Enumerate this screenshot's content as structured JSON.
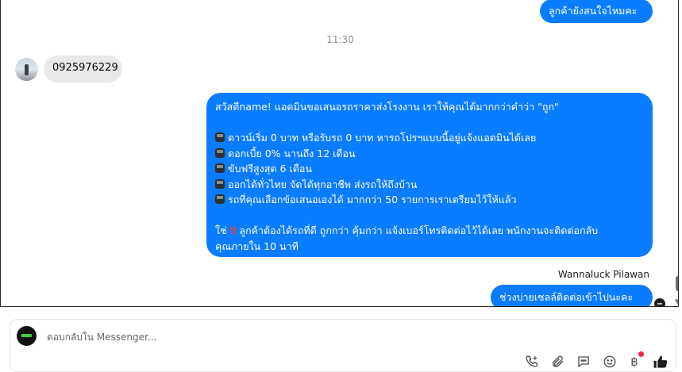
{
  "messages": {
    "top_outgoing": "ลูกค้ายังสนใจไหมคะ",
    "timestamp": "11:30",
    "incoming_phone": "0925976229",
    "long_outgoing": {
      "greeting": "สวัสดีname! แอดมินขอเสนอรถราคาส่งโรงงาน เราให้คุณได้มากกว่าคำว่า \"ถูก\"",
      "bullets": [
        "ดาวน์เริ่ม 0 บาท หรือรับรถ 0 บาท หารถโปรฯแบบนี้อยู่แจ้งแอดมินได้เลย",
        "ดอกเบี้ย 0% นานถึง 12 เดือน",
        "ขับฟรีสูงสุด 6 เดือน",
        "ออกได้ทั่วไทย จัดได้ทุกอาชีพ ส่งรถให้ถึงบ้าน",
        "รถที่คุณเลือกข้อเสนอเองได้ มากกว่า 50 รายการเราเตรียมไว้ให้แล้ว"
      ],
      "closing_prefix": "ใช่",
      "closing_rest": "ลูกค้าต้องได้รถที่ดี ถูกกว่า คุ้มกว่า แจ้งเบอร์โทรติดต่อไว้ได้เลย พนักงานจะติดต่อกลับ",
      "closing_line2": "คุณภายใน 10 นาที"
    },
    "sender_name": "Wannaluck Pilawan",
    "last_outgoing": "ช่วงบ่ายเซลล์ติดต่อเข้าไปนะคะ"
  },
  "composer": {
    "placeholder": "ตอบกลับใน Messenger..."
  },
  "icons": [
    "phone-plus-icon",
    "paperclip-icon",
    "chat-template-icon",
    "emoji-icon",
    "baht-icon",
    "like-icon"
  ],
  "colors": {
    "outgoing_bubble": "#0a7cff",
    "incoming_bubble": "#e9e9eb",
    "badge": "#f02849"
  }
}
